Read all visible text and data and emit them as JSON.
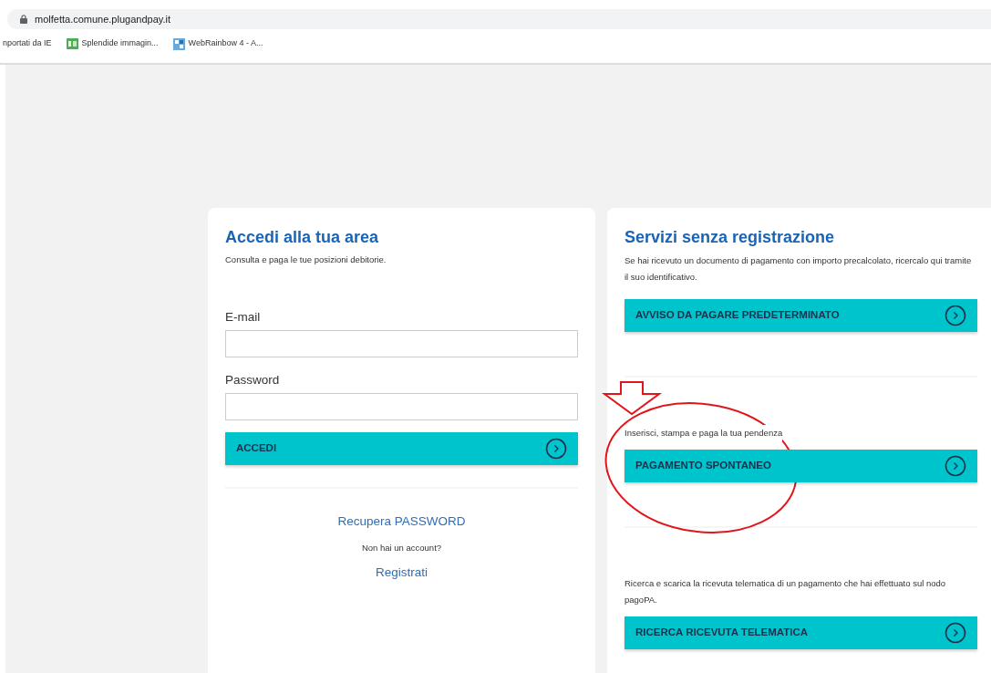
{
  "browser": {
    "url": "molfetta.comune.plugandpay.it",
    "bookmarks": [
      {
        "kind": "plain",
        "label": "nportati da IE"
      },
      {
        "kind": "px-logo",
        "label": "Splendide immagin..."
      },
      {
        "kind": "grid-logo",
        "label": "WebRainbow 4 - A..."
      }
    ]
  },
  "login_card": {
    "title": "Accedi alla tua area",
    "subtitle": "Consulta e paga le tue posizioni debitorie.",
    "fields": [
      {
        "label": "E-mail"
      },
      {
        "label": "Password"
      }
    ],
    "submit": "ACCEDI",
    "recover_link": "Recupera PASSWORD",
    "question": "Non hai un account?",
    "register_link": "Registrati"
  },
  "services_card": {
    "title": "Servizi senza registrazione",
    "sections": [
      {
        "description": "Se hai ricevuto un documento di pagamento con importo precalcolato, ricercalo qui tramite il suo identificativo.",
        "button": "AVVISO DA PAGARE PREDETERMINATO"
      },
      {
        "description": "Inserisci, stampa e paga la tua pendenza",
        "button": "PAGAMENTO SPONTANEO"
      },
      {
        "description": "Ricerca e scarica la ricevuta telematica di un pagamento che hai effettuato sul nodo pagoPA.",
        "button": "RICERCA RICEVUTA TELEMATICA"
      }
    ]
  },
  "annotations": {
    "arrow_shown": true,
    "ellipse_shown": true
  }
}
